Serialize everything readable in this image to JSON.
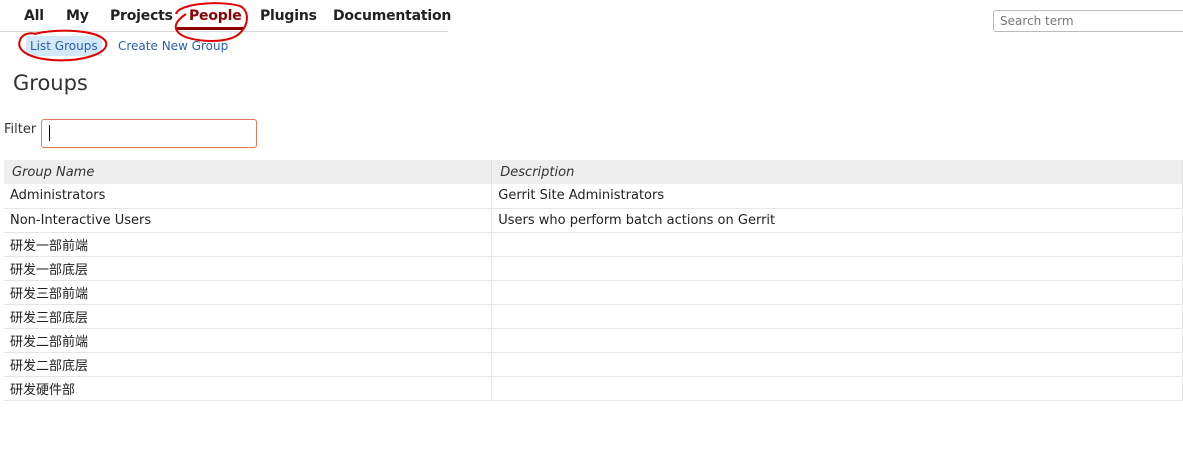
{
  "topmenu": {
    "tabs": [
      {
        "label": "All"
      },
      {
        "label": "My"
      },
      {
        "label": "Projects"
      },
      {
        "label": "People",
        "active": true
      },
      {
        "label": "Plugins"
      },
      {
        "label": "Documentation"
      }
    ]
  },
  "search": {
    "placeholder": "Search term",
    "value": ""
  },
  "submenu": {
    "items": [
      {
        "label": "List Groups",
        "selected": true
      },
      {
        "label": "Create New Group"
      }
    ]
  },
  "page": {
    "title": "Groups"
  },
  "filter": {
    "label": "Filter",
    "value": ""
  },
  "table": {
    "headers": [
      "Group Name",
      "Description"
    ],
    "rows": [
      {
        "name": "Administrators",
        "description": "Gerrit Site Administrators"
      },
      {
        "name": "Non-Interactive Users",
        "description": "Users who perform batch actions on Gerrit"
      },
      {
        "name": "研发一部前端",
        "description": ""
      },
      {
        "name": "研发一部底层",
        "description": ""
      },
      {
        "name": "研发三部前端",
        "description": ""
      },
      {
        "name": "研发三部底层",
        "description": ""
      },
      {
        "name": "研发二部前端",
        "description": ""
      },
      {
        "name": "研发二部底层",
        "description": ""
      },
      {
        "name": "研发硬件部",
        "description": ""
      }
    ]
  },
  "colors": {
    "active_tab": "#8b0000",
    "link": "#2a5db0",
    "selected_bg": "#d4e9f7",
    "annotation": "#e00000"
  }
}
